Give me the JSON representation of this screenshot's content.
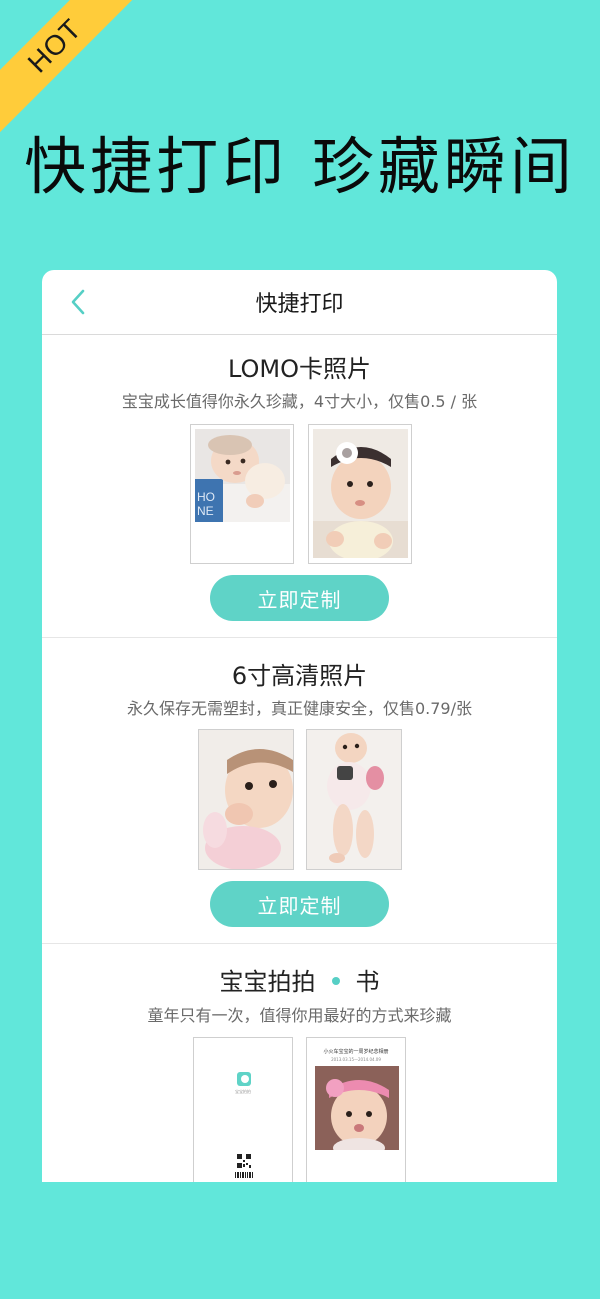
{
  "ribbon": {
    "label": "HOT"
  },
  "hero": {
    "title": "快捷打印 珍藏瞬间"
  },
  "nav": {
    "title": "快捷打印"
  },
  "sections": [
    {
      "title": "LOMO卡照片",
      "subtitle": "宝宝成长值得你永久珍藏，4寸大小，仅售0.5 / 张",
      "button": "立即定制"
    },
    {
      "title": "6寸高清照片",
      "subtitle": "永久保存无需塑封，真正健康安全，仅售0.79/张",
      "button": "立即定制"
    },
    {
      "title_left": "宝宝拍拍",
      "title_right": "书",
      "subtitle": "童年只有一次，值得你用最好的方式来珍藏",
      "book_title": "小火车宝宝的一周岁纪念相册",
      "book_date": "2013.03.15—2014.04.09",
      "book_cover_logo": "宝宝拍拍"
    }
  ],
  "colors": {
    "background": "#61e7da",
    "ribbon": "#ffcc3a",
    "accent": "#5fd3c7",
    "dot": "#56cfc5"
  },
  "icons": {
    "back": "chevron-left-icon",
    "logo": "app-logo-icon",
    "qr": "qr-code-icon",
    "barcode": "barcode-icon"
  }
}
